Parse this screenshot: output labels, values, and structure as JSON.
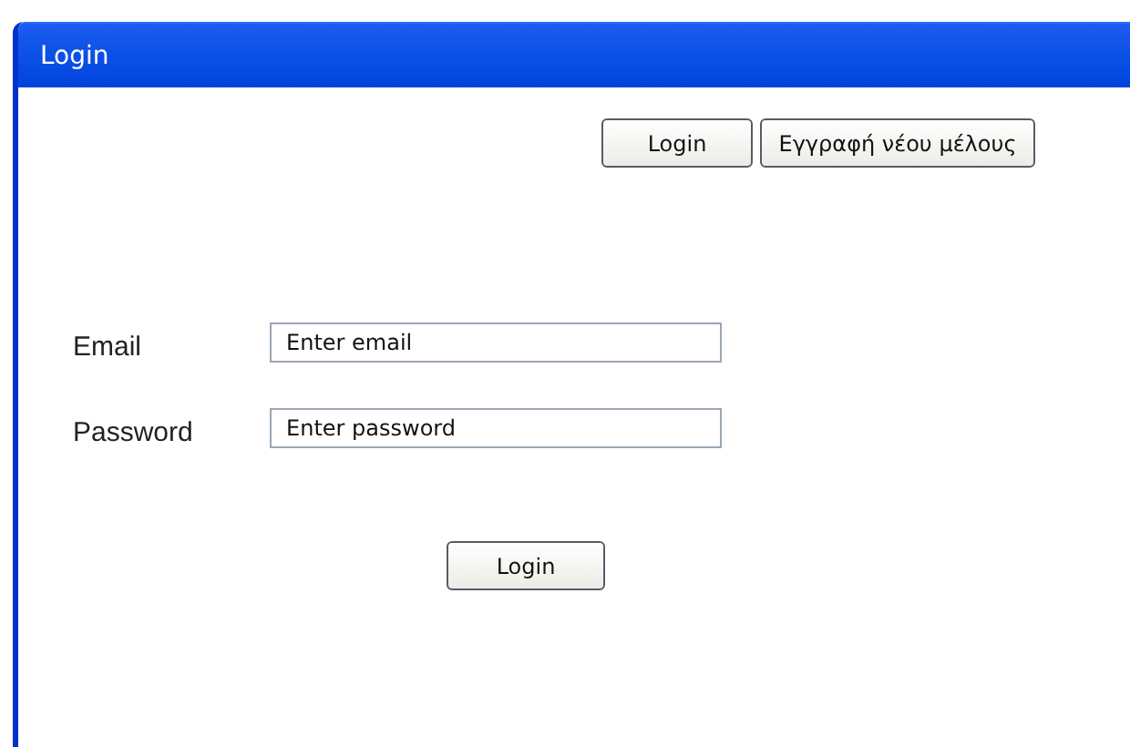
{
  "window": {
    "title": "Login"
  },
  "toolbar": {
    "buttons": [
      "Login",
      "Εγγραφή νέου μέλους"
    ]
  },
  "form": {
    "fields": [
      {
        "label": "Email",
        "placeholder": "Enter email"
      },
      {
        "label": "Password",
        "placeholder": "Enter password"
      }
    ],
    "submit": "Login"
  }
}
